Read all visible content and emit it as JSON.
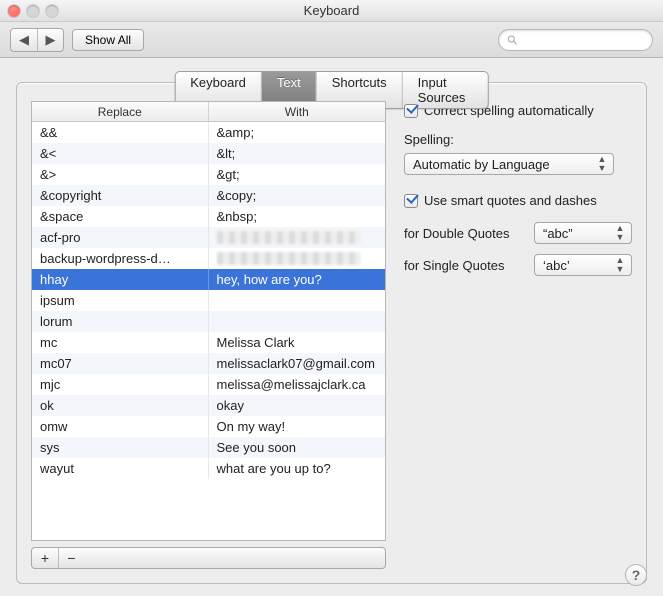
{
  "window": {
    "title": "Keyboard"
  },
  "toolbar": {
    "back_icon": "◀",
    "forward_icon": "▶",
    "show_all": "Show All",
    "search_placeholder": ""
  },
  "tabs": [
    {
      "label": "Keyboard",
      "active": false
    },
    {
      "label": "Text",
      "active": true
    },
    {
      "label": "Shortcuts",
      "active": false
    },
    {
      "label": "Input Sources",
      "active": false
    }
  ],
  "table": {
    "headers": {
      "replace": "Replace",
      "with": "With"
    },
    "rows": [
      {
        "replace": "&&",
        "with": "&amp;",
        "selected": false
      },
      {
        "replace": "&<",
        "with": "&lt;",
        "selected": false
      },
      {
        "replace": "&>",
        "with": "&gt;",
        "selected": false
      },
      {
        "replace": "&copyright",
        "with": "&copy;",
        "selected": false
      },
      {
        "replace": "&space",
        "with": "&nbsp;",
        "selected": false
      },
      {
        "replace": "acf-pro",
        "with": "",
        "redacted": true,
        "selected": false
      },
      {
        "replace": "backup-wordpress-d…",
        "with": "",
        "redacted": true,
        "selected": false
      },
      {
        "replace": "hhay",
        "with": "hey, how are you?",
        "selected": true
      },
      {
        "replace": "ipsum",
        "with": "",
        "selected": false
      },
      {
        "replace": "lorum",
        "with": "",
        "selected": false
      },
      {
        "replace": "mc",
        "with": "Melissa Clark",
        "selected": false
      },
      {
        "replace": "mc07",
        "with": "melissaclark07@gmail.com",
        "selected": false
      },
      {
        "replace": "mjc",
        "with": "melissa@melissajclark.ca",
        "selected": false
      },
      {
        "replace": "ok",
        "with": "okay",
        "selected": false
      },
      {
        "replace": "omw",
        "with": "On my way!",
        "selected": false
      },
      {
        "replace": "sys",
        "with": "See you soon",
        "selected": false
      },
      {
        "replace": "wayut",
        "with": "what are you up to?",
        "selected": false
      }
    ],
    "add_label": "+",
    "remove_label": "−"
  },
  "options": {
    "correct_spelling": {
      "checked": true,
      "label": "Correct spelling automatically"
    },
    "spelling_label": "Spelling:",
    "spelling_value": "Automatic by Language",
    "smart_quotes": {
      "checked": true,
      "label": "Use smart quotes and dashes"
    },
    "double_label": "for Double Quotes",
    "double_value": "“abc”",
    "single_label": "for Single Quotes",
    "single_value": "‘abc’"
  },
  "help_label": "?"
}
